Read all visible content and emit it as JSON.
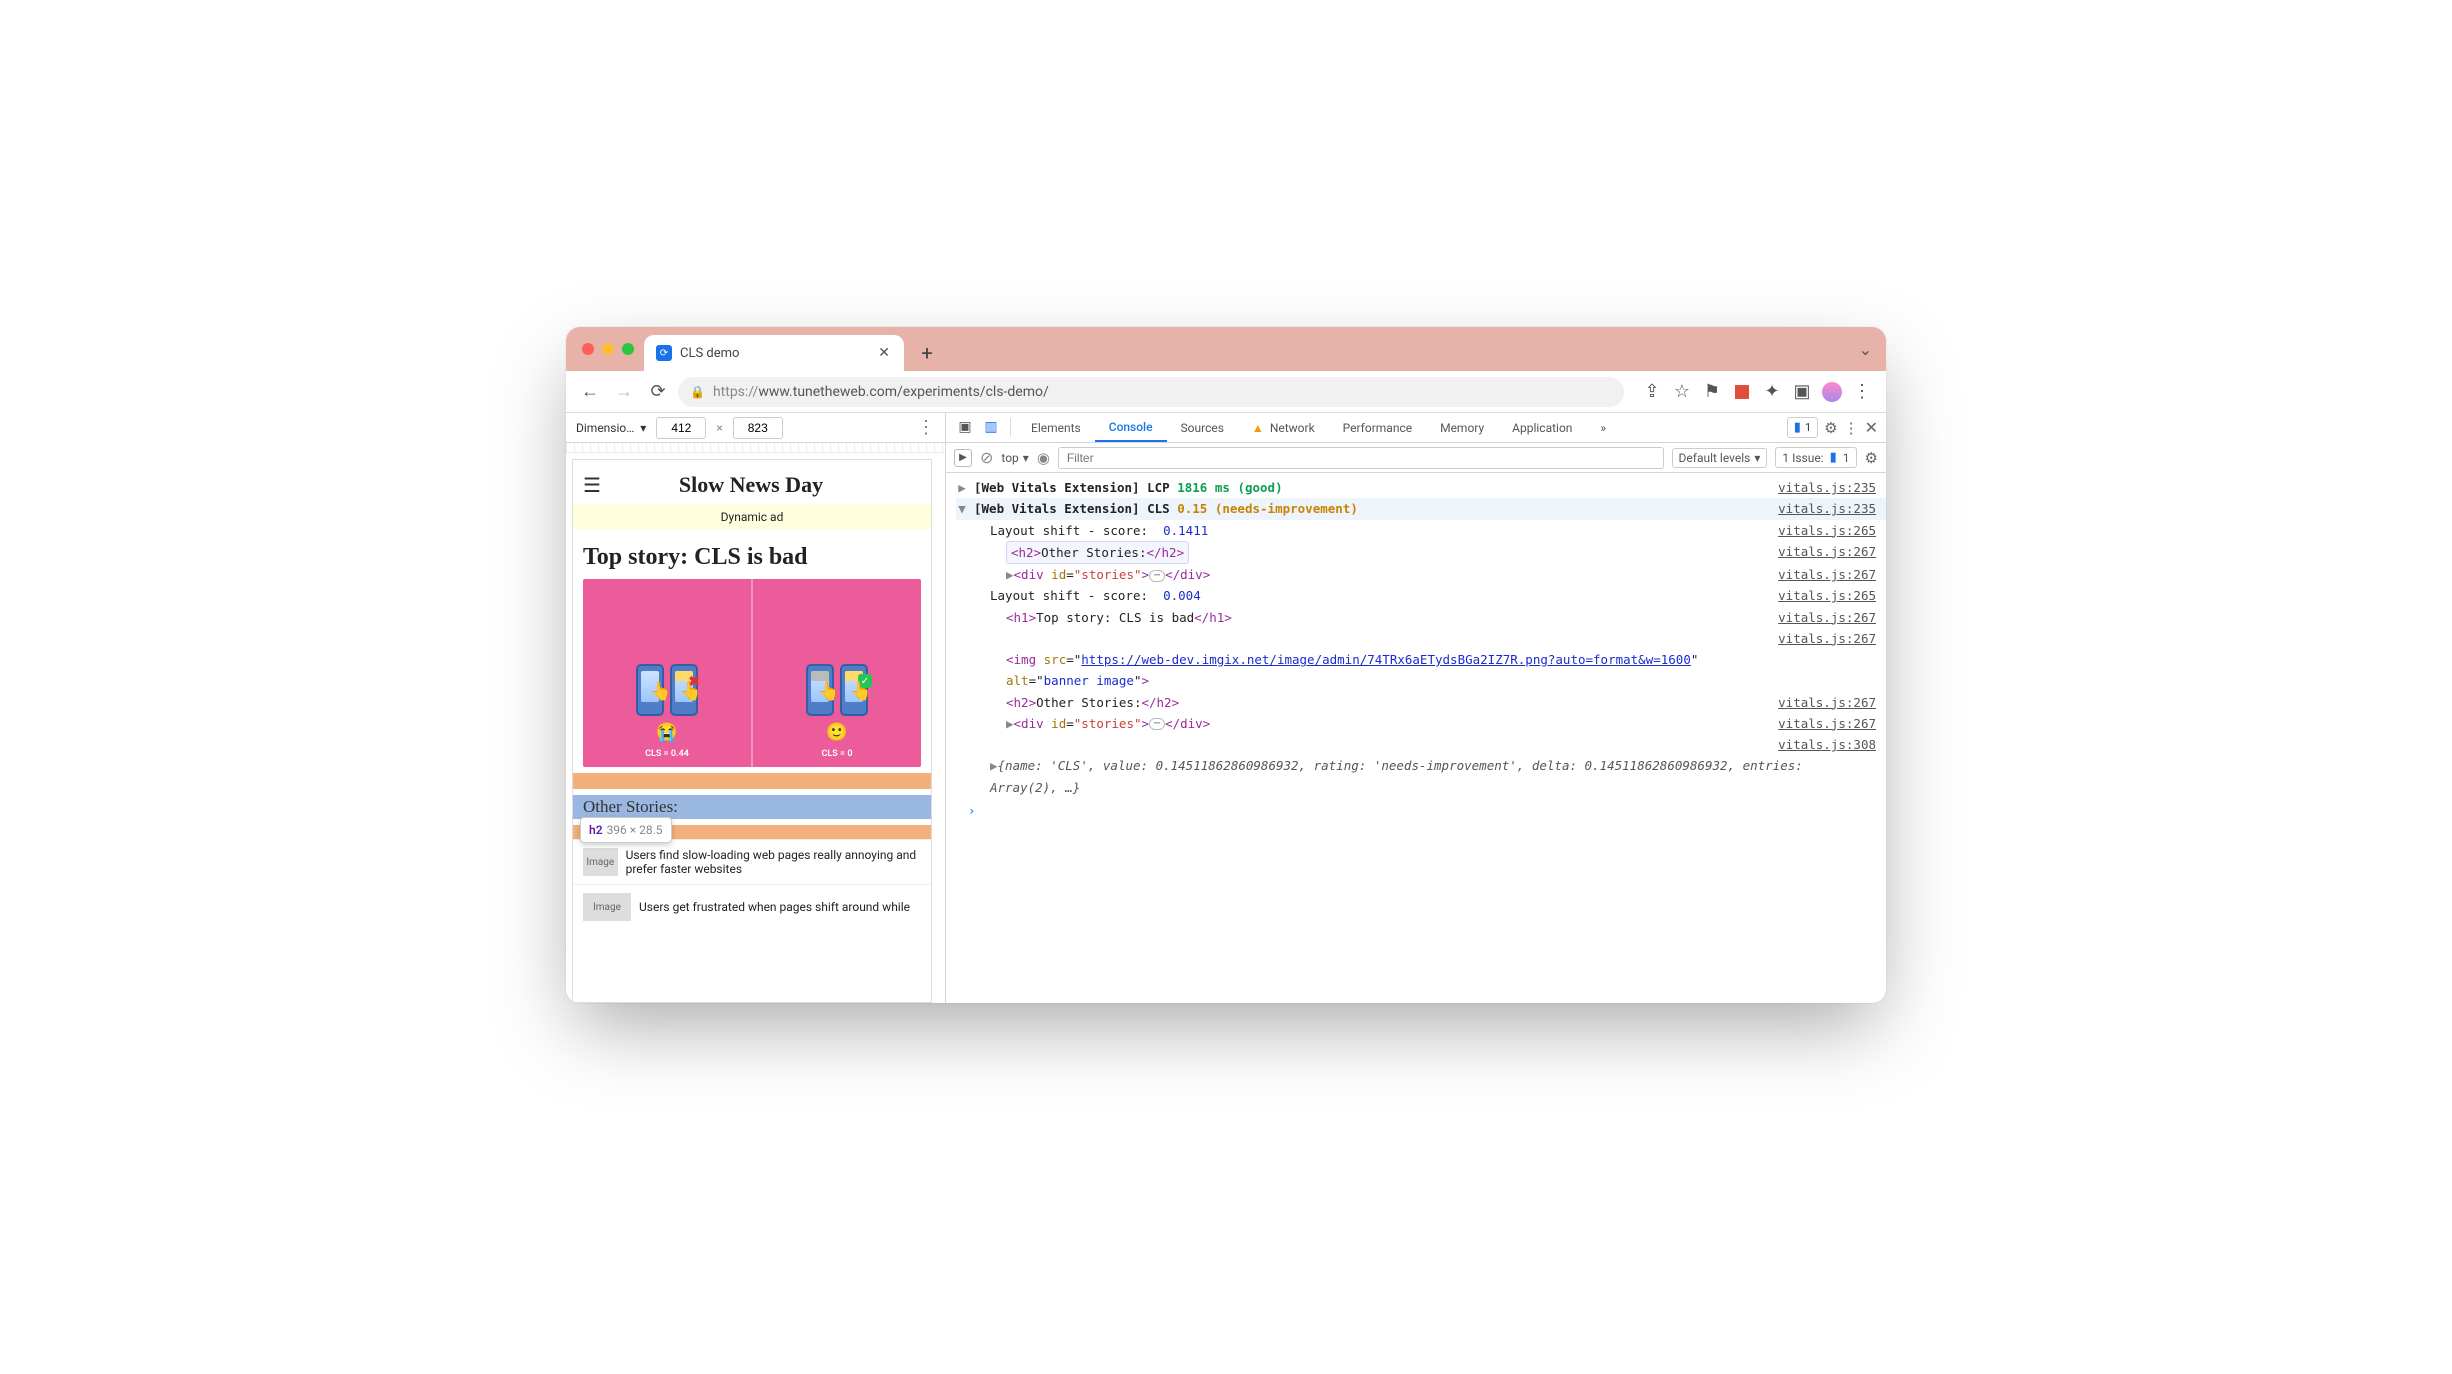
{
  "browser": {
    "tab_title": "CLS demo",
    "url_scheme": "https://",
    "url_rest": "www.tunetheweb.com/experiments/cls-demo/"
  },
  "responsive": {
    "label": "Dimensio…",
    "width": "412",
    "height": "823"
  },
  "page": {
    "site_title": "Slow News Day",
    "ad_text": "Dynamic ad",
    "headline": "Top story: CLS is bad",
    "hero_left_caption": "CLS = 0.44",
    "hero_right_caption": "CLS = 0",
    "other_stories_h2": "Other Stories:",
    "tooltip_tag": "h2",
    "tooltip_dims": "396 × 28.5",
    "image_label": "Image",
    "story1": "Users find slow-loading web pages really annoying and prefer faster websites",
    "story2": "Users get frustrated when pages shift around while"
  },
  "devtools": {
    "tabs": [
      "Elements",
      "Console",
      "Sources",
      "Network",
      "Performance",
      "Memory",
      "Application"
    ],
    "top_label": "top",
    "filter_placeholder": "Filter",
    "levels_label": "Default levels",
    "issues_label": "1 Issue:",
    "issues_count": "1",
    "bubble_count": "1"
  },
  "console": {
    "prefix": "[Web Vitals Extension]",
    "lcp_label": "LCP",
    "lcp_value": "1816 ms",
    "lcp_status": "(good)",
    "cls_label": "CLS",
    "cls_value": "0.15",
    "cls_status": "(needs-improvement)",
    "shift_label": "Layout shift - score:",
    "shift1_score": "0.1411",
    "shift2_score": "0.004",
    "h2_html_open": "<h2>",
    "h2_html_text": "Other Stories:",
    "h2_html_close": "</h2>",
    "stories_div_open": "<div ",
    "stories_div_attr_name": "id",
    "stories_div_attr_val": "\"stories\"",
    "stories_div_mid": ">",
    "stories_div_close": "</div>",
    "h1_open": "<h1>",
    "h1_text": "Top story: CLS is bad",
    "h1_close": "</h1>",
    "img_open": "<img ",
    "img_src_name": "src",
    "img_src_val": "https://web-dev.imgix.net/image/admin/74TRx6aETydsBGa2IZ7R.png?auto=format&w=1600",
    "img_alt_name": "alt",
    "img_alt_val": "banner image",
    "img_close": ">",
    "obj_text": "{name: 'CLS', value: 0.14511862860986932, rating: 'needs-improvement', delta: 0.14511862860986932, entries: Array(2), …}",
    "links": {
      "l235": "vitals.js:235",
      "l265": "vitals.js:265",
      "l267": "vitals.js:267",
      "l308": "vitals.js:308"
    }
  }
}
